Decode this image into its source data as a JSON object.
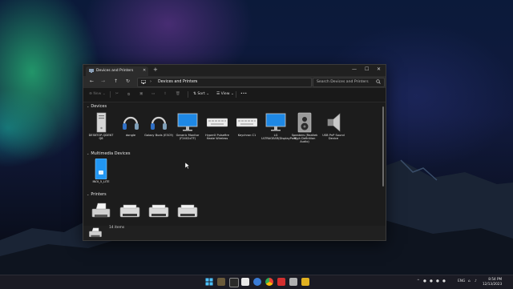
{
  "window": {
    "tab_title": "Devices and Printers",
    "tab_close": "✕",
    "new_tab": "+",
    "minimize": "—",
    "maximize": "☐",
    "close": "✕"
  },
  "navigation": {
    "back": "←",
    "forward": "→",
    "up": "↑",
    "refresh": "↻",
    "chevron": "›",
    "breadcrumb": "Devices and Printers",
    "search_placeholder": "Search Devices and Printers"
  },
  "toolbar": {
    "new_label": "New",
    "sort_label": "Sort",
    "view_label": "View",
    "more_label": "•••"
  },
  "groups": {
    "devices": {
      "label": "Devices",
      "items": [
        {
          "label": "DESKTOP-QDENT Q8",
          "icon": "computer-tower-icon"
        },
        {
          "label": "dongle",
          "icon": "headset-icon"
        },
        {
          "label": "Galaxy Buds (E3C9)",
          "icon": "headset-icon"
        },
        {
          "label": "Generic Monitor (F2402xTF)",
          "icon": "monitor-icon"
        },
        {
          "label": "HyperX Pulsefire Haste Wireless",
          "icon": "keyboard-icon"
        },
        {
          "label": "Keychron C1",
          "icon": "keyboard-icon"
        },
        {
          "label": "LG ULTRAGEAR(DisplayPort)",
          "icon": "monitor-icon"
        },
        {
          "label": "Speakers (Realtek High Definition Audio)",
          "icon": "speaker-icon"
        },
        {
          "label": "USB PnP Sound Device",
          "icon": "usb-speaker-icon"
        }
      ]
    },
    "multimedia": {
      "label": "Multimedia Devices",
      "items": [
        {
          "label": "INOI_5_LITE",
          "icon": "phone-icon"
        }
      ]
    },
    "printers": {
      "label": "Printers",
      "items": [
        {
          "label": "",
          "icon": "fax-icon"
        },
        {
          "label": "",
          "icon": "printer-icon"
        },
        {
          "label": "",
          "icon": "printer-icon"
        },
        {
          "label": "",
          "icon": "printer-icon"
        }
      ]
    }
  },
  "status": {
    "item_count": "14 items"
  },
  "taskbar": {
    "clock_time": "8:54 PM",
    "clock_date": "12/13/2023",
    "tray_lang": "ENG",
    "tray_chevron": "^"
  },
  "colors": {
    "window_bg": "#1c1c1c",
    "selection": "#4a8fd8",
    "monitor_screen": "#1e88e5"
  }
}
